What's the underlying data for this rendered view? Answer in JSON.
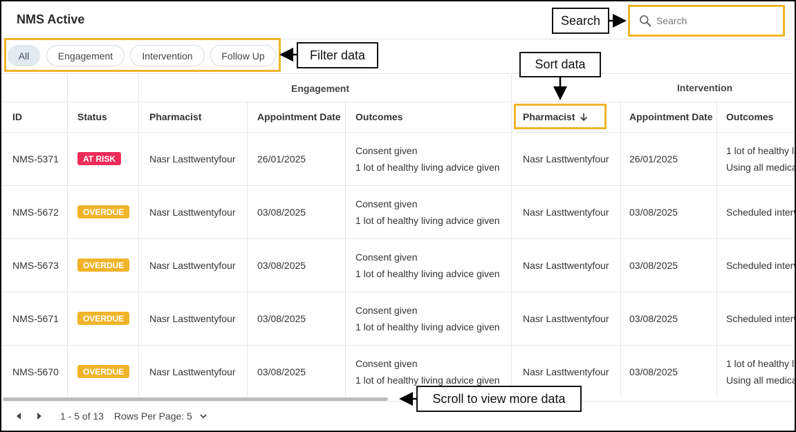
{
  "header": {
    "title": "NMS Active"
  },
  "search": {
    "placeholder": "Search"
  },
  "filters": [
    "All",
    "Engagement",
    "Intervention",
    "Follow Up"
  ],
  "callouts": {
    "search": "Search",
    "filter": "Filter data",
    "sort": "Sort data",
    "scroll": "Scroll to view more data"
  },
  "table": {
    "groups": {
      "engagement": "Engagement",
      "intervention": "Intervention"
    },
    "columns": [
      "ID",
      "Status",
      "Pharmacist",
      "Appointment Date",
      "Outcomes",
      "Pharmacist",
      "Appointment Date",
      "Outcomes"
    ],
    "rows": [
      {
        "id": "NMS-5371",
        "status": "AT RISK",
        "eng_pharmacist": "Nasr Lasttwentyfour",
        "eng_date": "26/01/2025",
        "eng_out1": "Consent given",
        "eng_out2": "1 lot of healthy living advice given",
        "int_pharmacist": "Nasr Lasttwentyfour",
        "int_date": "26/01/2025",
        "int_out1": "1 lot of healthy li",
        "int_out2": "Using all medica"
      },
      {
        "id": "NMS-5672",
        "status": "OVERDUE",
        "eng_pharmacist": "Nasr Lasttwentyfour",
        "eng_date": "03/08/2025",
        "eng_out1": "Consent given",
        "eng_out2": "1 lot of healthy living advice given",
        "int_pharmacist": "Nasr Lasttwentyfour",
        "int_date": "03/08/2025",
        "int_out1": "Scheduled interv",
        "int_out2": ""
      },
      {
        "id": "NMS-5673",
        "status": "OVERDUE",
        "eng_pharmacist": "Nasr Lasttwentyfour",
        "eng_date": "03/08/2025",
        "eng_out1": "Consent given",
        "eng_out2": "1 lot of healthy living advice given",
        "int_pharmacist": "Nasr Lasttwentyfour",
        "int_date": "03/08/2025",
        "int_out1": "Scheduled interv",
        "int_out2": ""
      },
      {
        "id": "NMS-5671",
        "status": "OVERDUE",
        "eng_pharmacist": "Nasr Lasttwentyfour",
        "eng_date": "03/08/2025",
        "eng_out1": "Consent given",
        "eng_out2": "1 lot of healthy living advice given",
        "int_pharmacist": "Nasr Lasttwentyfour",
        "int_date": "03/08/2025",
        "int_out1": "Scheduled interv",
        "int_out2": ""
      },
      {
        "id": "NMS-5670",
        "status": "OVERDUE",
        "eng_pharmacist": "Nasr Lasttwentyfour",
        "eng_date": "03/08/2025",
        "eng_out1": "Consent given",
        "eng_out2": "1 lot of healthy living advice given",
        "int_pharmacist": "Nasr Lasttwentyfour",
        "int_date": "03/08/2025",
        "int_out1": "1 lot of healthy li",
        "int_out2": "Using all medica"
      }
    ]
  },
  "pagination": {
    "range": "1 - 5 of 13",
    "rows_label": "Rows Per Page:",
    "rows_value": "5"
  },
  "colors": {
    "highlight": "#f0b429",
    "at_risk": "#ee2c5a",
    "overdue": "#f0b429",
    "active_chip": "#e1e9f3"
  }
}
